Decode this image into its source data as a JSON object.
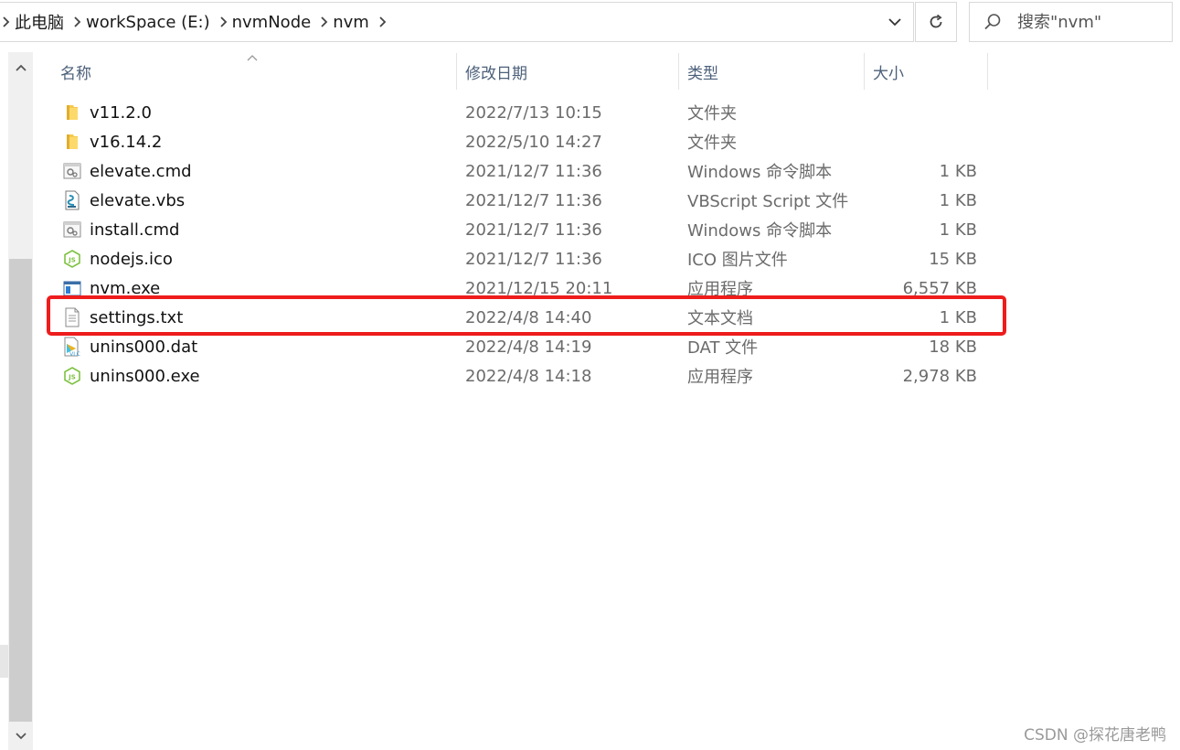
{
  "breadcrumb": [
    "此电脑",
    "workSpace (E:)",
    "nvmNode",
    "nvm"
  ],
  "search": {
    "placeholder": "搜索\"nvm\""
  },
  "columns": {
    "name": "名称",
    "date": "修改日期",
    "type": "类型",
    "size": "大小"
  },
  "files": [
    {
      "icon": "folder-icon",
      "name": "v11.2.0",
      "date": "2022/7/13 10:15",
      "type": "文件夹",
      "size": ""
    },
    {
      "icon": "folder-icon",
      "name": "v16.14.2",
      "date": "2022/5/10 14:27",
      "type": "文件夹",
      "size": ""
    },
    {
      "icon": "cmd-script-icon",
      "name": "elevate.cmd",
      "date": "2021/12/7 11:36",
      "type": "Windows 命令脚本",
      "size": "1 KB"
    },
    {
      "icon": "vbs-script-icon",
      "name": "elevate.vbs",
      "date": "2021/12/7 11:36",
      "type": "VBScript Script 文件",
      "size": "1 KB"
    },
    {
      "icon": "cmd-script-icon",
      "name": "install.cmd",
      "date": "2021/12/7 11:36",
      "type": "Windows 命令脚本",
      "size": "1 KB"
    },
    {
      "icon": "nodejs-icon",
      "name": "nodejs.ico",
      "date": "2021/12/7 11:36",
      "type": "ICO 图片文件",
      "size": "15 KB"
    },
    {
      "icon": "exe-app-icon",
      "name": "nvm.exe",
      "date": "2021/12/15 20:11",
      "type": "应用程序",
      "size": "6,557 KB"
    },
    {
      "icon": "text-file-icon",
      "name": "settings.txt",
      "date": "2022/4/8 14:40",
      "type": "文本文档",
      "size": "1 KB"
    },
    {
      "icon": "dat-file-icon",
      "name": "unins000.dat",
      "date": "2022/4/8 14:19",
      "type": "DAT 文件",
      "size": "18 KB"
    },
    {
      "icon": "nodejs-icon",
      "name": "unins000.exe",
      "date": "2022/4/8 14:18",
      "type": "应用程序",
      "size": "2,978 KB"
    }
  ],
  "highlighted_file": "settings.txt",
  "highlight_color": "#ee1c1c",
  "watermark": "CSDN @探花唐老鸭"
}
